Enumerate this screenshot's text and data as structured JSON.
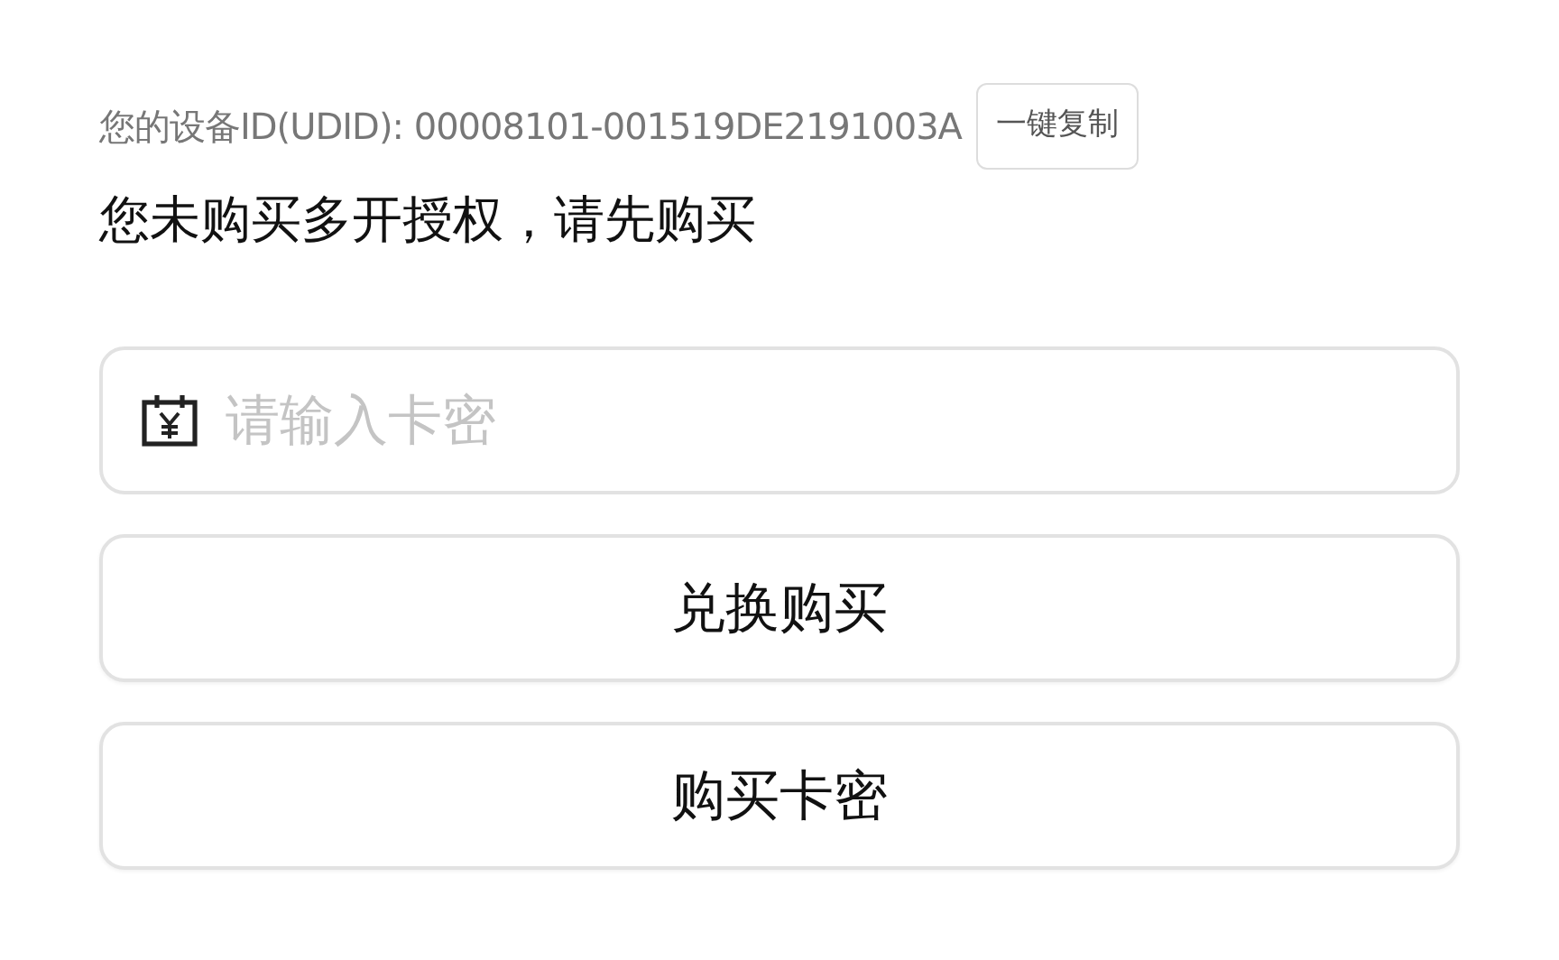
{
  "device_id_label": "您的设备ID(UDID): 00008101-001519DE2191003A",
  "copy_button": "一键复制",
  "notice": "您未购买多开授权，请先购买",
  "card_field": {
    "placeholder": "请输入卡密"
  },
  "buttons": [
    "兑换购买",
    "购买卡密"
  ]
}
